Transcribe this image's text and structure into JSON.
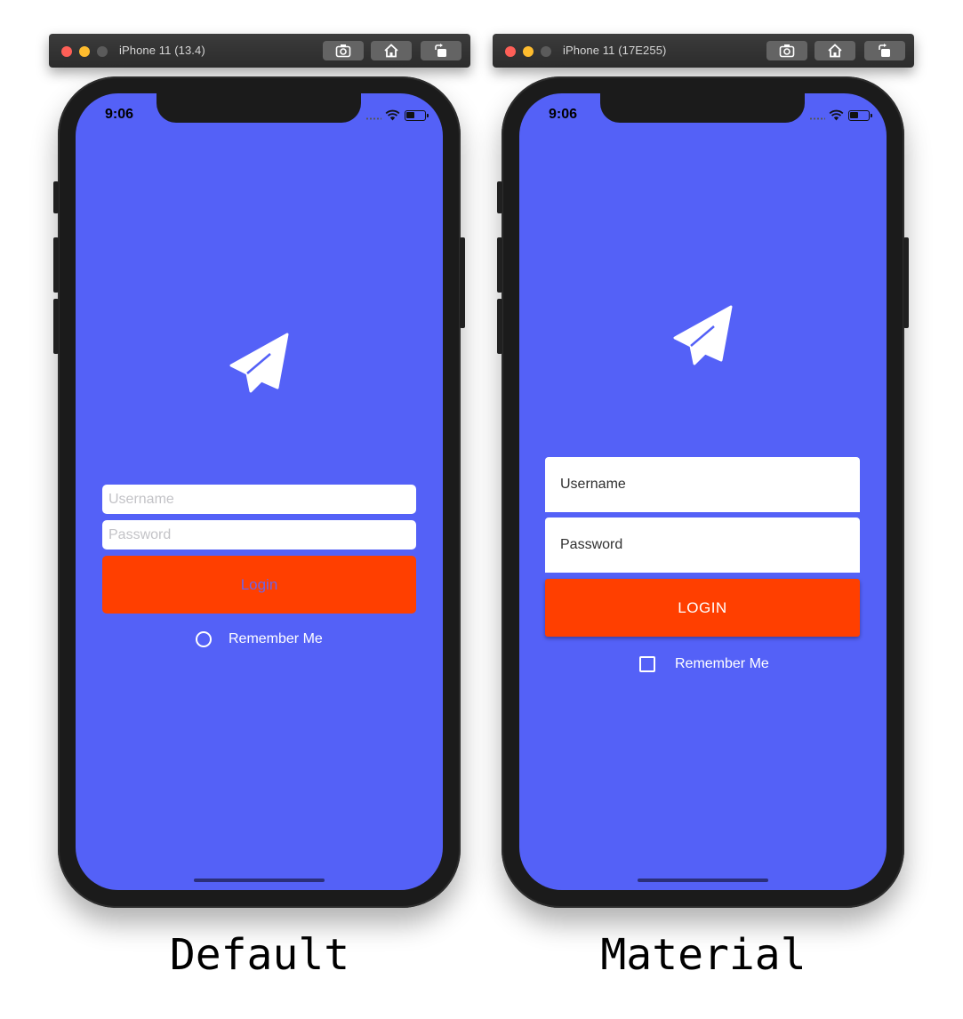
{
  "simulators": [
    {
      "device_title": "iPhone 11 (13.4)",
      "status_time": "9:06",
      "style": "Default",
      "username_placeholder": "Username",
      "password_placeholder": "Password",
      "login_label": "Login",
      "remember_label": "Remember Me"
    },
    {
      "device_title": "iPhone 11 (17E255)",
      "status_time": "9:06",
      "style": "Material",
      "username_placeholder": "Username",
      "password_placeholder": "Password",
      "login_label": "LOGIN",
      "remember_label": "Remember Me"
    }
  ],
  "toolbar_icons": [
    "screenshot-icon",
    "home-icon",
    "rotate-icon"
  ],
  "colors": {
    "screen_bg": "#5461f7",
    "login_button": "#ff3f00",
    "titlebar": "#333333"
  }
}
